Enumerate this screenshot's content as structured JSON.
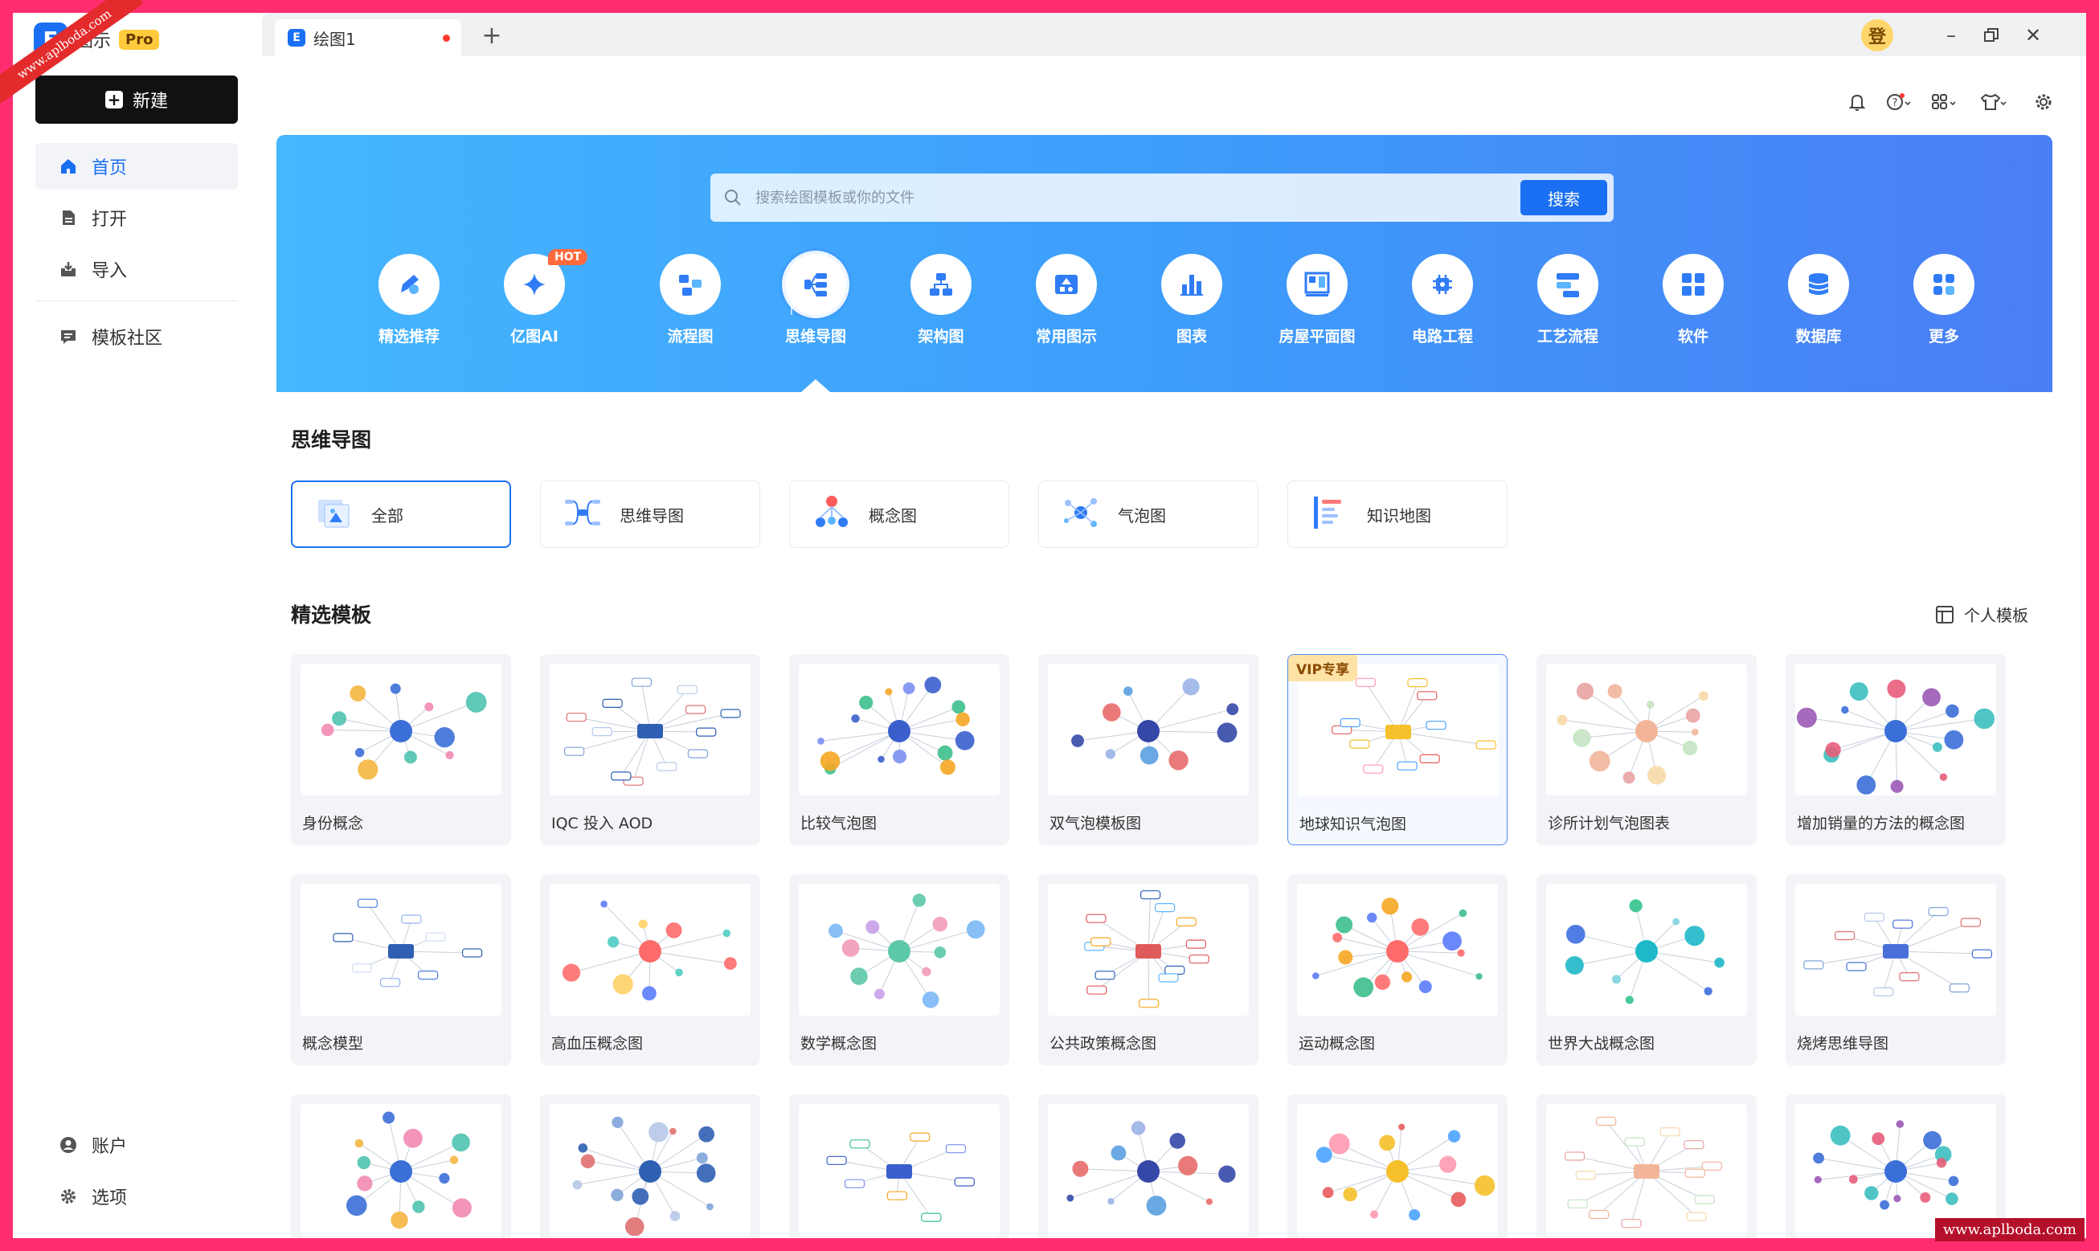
{
  "app": {
    "name": "图示",
    "edition": "Pro"
  },
  "sidebar": {
    "new_label": "新建",
    "items": [
      {
        "label": "首页",
        "icon": "home-icon",
        "active": true
      },
      {
        "label": "打开",
        "icon": "file-icon"
      },
      {
        "label": "导入",
        "icon": "import-icon"
      },
      {
        "label": "模板社区",
        "icon": "community-icon"
      }
    ],
    "bottom": [
      {
        "label": "账户",
        "icon": "user-icon"
      },
      {
        "label": "选项",
        "icon": "gear-icon"
      }
    ]
  },
  "tabs": [
    {
      "label": "绘图1",
      "unsaved": true
    }
  ],
  "login_label": "登",
  "search": {
    "placeholder": "搜索绘图模板或你的文件",
    "button": "搜索"
  },
  "categories": [
    {
      "label": "精选推荐"
    },
    {
      "label": "亿图AI",
      "badge": "HOT"
    },
    {
      "label": "流程图"
    },
    {
      "label": "思维导图",
      "active": true
    },
    {
      "label": "架构图"
    },
    {
      "label": "常用图示"
    },
    {
      "label": "图表"
    },
    {
      "label": "房屋平面图"
    },
    {
      "label": "电路工程"
    },
    {
      "label": "工艺流程"
    },
    {
      "label": "软件"
    },
    {
      "label": "数据库"
    },
    {
      "label": "更多"
    }
  ],
  "section1": {
    "title": "思维导图",
    "subcategories": [
      {
        "label": "全部",
        "active": true
      },
      {
        "label": "思维导图"
      },
      {
        "label": "概念图"
      },
      {
        "label": "气泡图"
      },
      {
        "label": "知识地图"
      }
    ]
  },
  "section2": {
    "title": "精选模板",
    "personal_label": "个人模板",
    "templates": [
      {
        "name": "身份概念"
      },
      {
        "name": "IQC 投入 AOD"
      },
      {
        "name": "比较气泡图"
      },
      {
        "name": "双气泡模板图"
      },
      {
        "name": "地球知识气泡图",
        "badge": "VIP专享"
      },
      {
        "name": "诊所计划气泡图表"
      },
      {
        "name": "增加销量的方法的概念图"
      },
      {
        "name": "概念模型"
      },
      {
        "name": "高血压概念图"
      },
      {
        "name": "数学概念图"
      },
      {
        "name": "公共政策概念图"
      },
      {
        "name": "运动概念图"
      },
      {
        "name": "世界大战概念图"
      },
      {
        "name": "烧烤思维导图"
      },
      {
        "name": ""
      },
      {
        "name": ""
      },
      {
        "name": ""
      },
      {
        "name": ""
      },
      {
        "name": ""
      },
      {
        "name": ""
      },
      {
        "name": ""
      }
    ]
  },
  "watermark": {
    "ribbon": "www.aplboda.com",
    "corner": "www.aplboda.com"
  },
  "colors": {
    "accent": "#1a6ff2",
    "frame": "#ff2d6f",
    "hero_start": "#45b6ff",
    "hero_end": "#4a7ef5"
  }
}
